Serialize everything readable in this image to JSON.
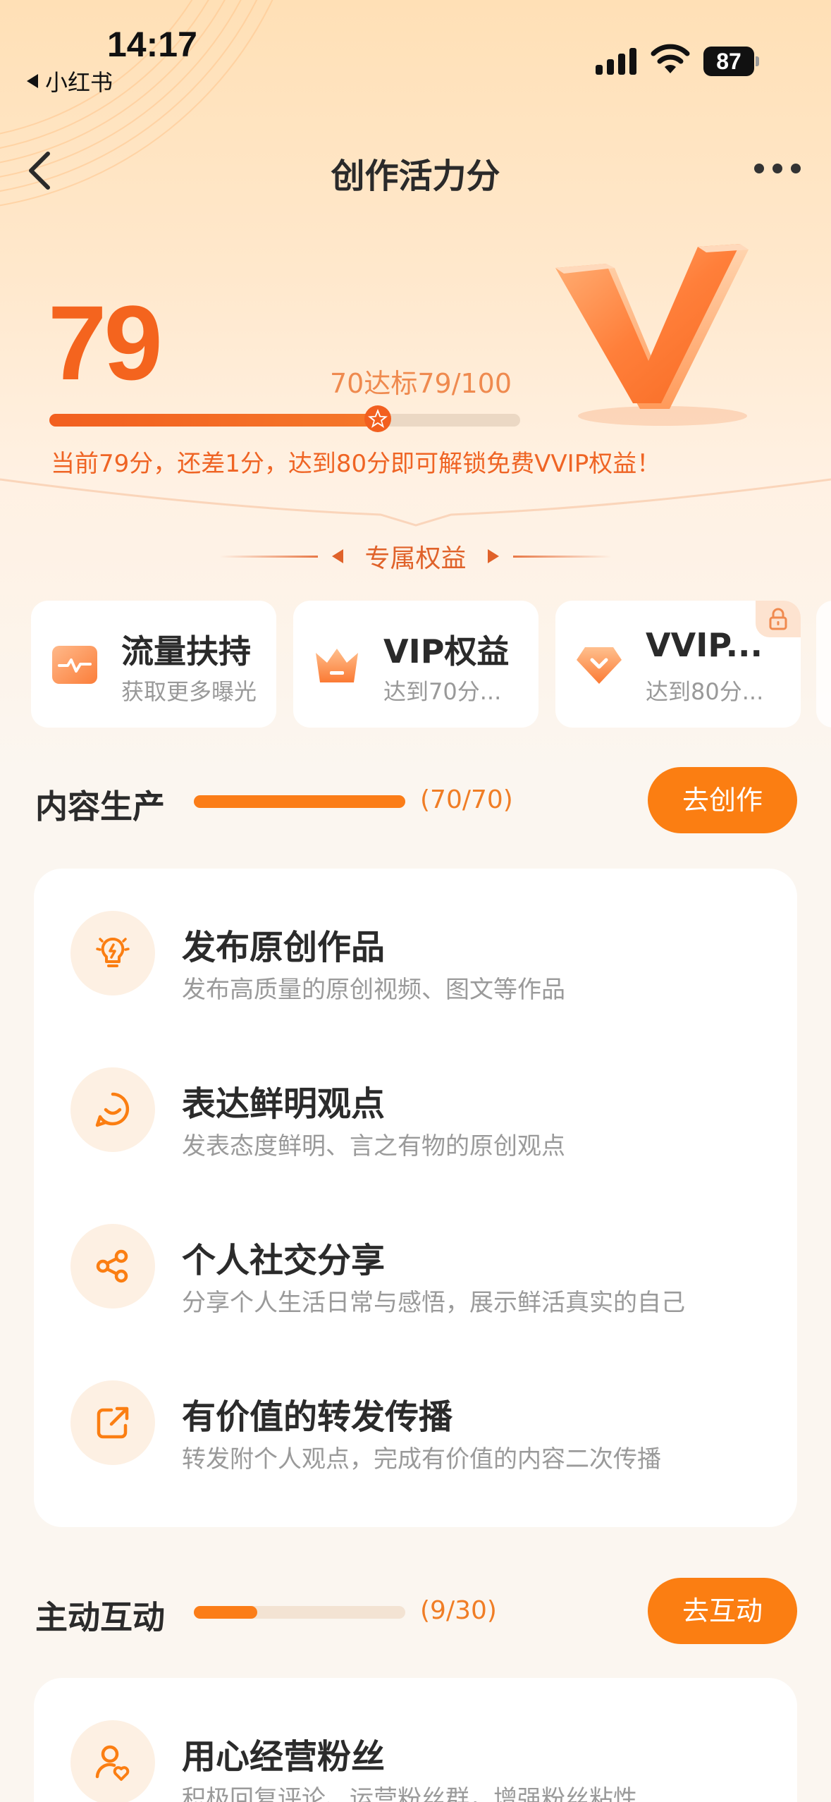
{
  "status_bar": {
    "time": "14:17",
    "back_app": "小红书",
    "battery": "87"
  },
  "nav": {
    "title": "创作活力分"
  },
  "score": {
    "value": "79",
    "target_text": "70达标79/100",
    "progress": 0.79,
    "message": "当前79分，还差1分，达到80分即可解锁免费VVIP权益！"
  },
  "benefits": {
    "header": "专属权益",
    "cards": [
      {
        "title": "流量扶持",
        "subtitle": "获取更多曝光",
        "icon": "traffic-chart-icon"
      },
      {
        "title": "VIP权益",
        "subtitle": "达到70分...",
        "icon": "crown-icon"
      },
      {
        "title": "VVIP...",
        "subtitle": "达到80分...",
        "icon": "diamond-icon",
        "locked": true
      }
    ]
  },
  "sections": [
    {
      "title": "内容生产",
      "count": "(70/70)",
      "progress": 1.0,
      "button": "去创作",
      "items": [
        {
          "title": "发布原创作品",
          "desc": "发布高质量的原创视频、图文等作品",
          "icon": "lightbulb-icon"
        },
        {
          "title": "表达鲜明观点",
          "desc": "发表态度鲜明、言之有物的原创观点",
          "icon": "chat-smile-icon"
        },
        {
          "title": "个人社交分享",
          "desc": "分享个人生活日常与感悟，展示鲜活真实的自己",
          "icon": "share-icon"
        },
        {
          "title": "有价值的转发传播",
          "desc": "转发附个人观点，完成有价值的内容二次传播",
          "icon": "forward-icon"
        }
      ]
    },
    {
      "title": "主动互动",
      "count": "(9/30)",
      "progress": 0.3,
      "button": "去互动",
      "items": [
        {
          "title": "用心经营粉丝",
          "desc": "积极回复评论、运营粉丝群，增强粉丝粘性",
          "icon": "fan-heart-icon"
        }
      ]
    }
  ],
  "colors": {
    "accent": "#fb7e12",
    "score": "#f4641e",
    "background": "#fbf6f0"
  }
}
